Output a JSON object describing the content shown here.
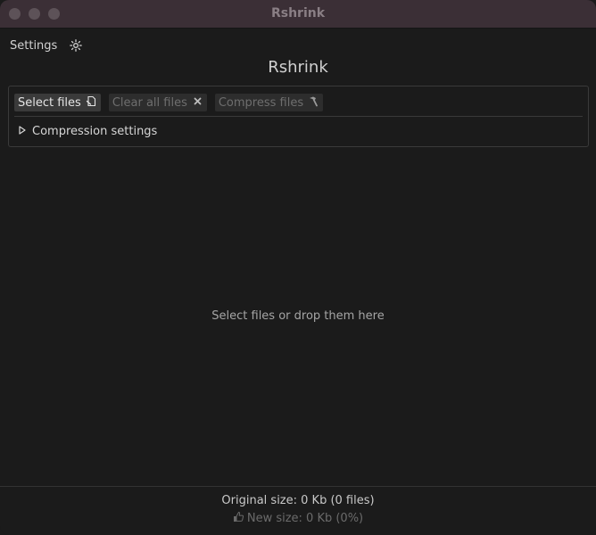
{
  "window": {
    "title": "Rshrink"
  },
  "menu": {
    "settings_label": "Settings",
    "theme_icon": "sun-icon"
  },
  "app": {
    "heading": "Rshrink"
  },
  "toolbar": {
    "select_files_label": "Select files",
    "select_files_icon": "file-hand-icon",
    "clear_all_label": "Clear all files",
    "clear_all_icon": "close-icon",
    "compress_label": "Compress files",
    "compress_icon": "hammer-icon"
  },
  "compression_settings": {
    "label": "Compression settings",
    "expanded": false
  },
  "drop_area": {
    "hint": "Select files or drop them here"
  },
  "status": {
    "original_size": "Original size: 0 Kb (0 files)",
    "new_size": "New size: 0 Kb (0%)",
    "new_size_icon": "thumbs-up-icon"
  },
  "colors": {
    "titlebar": "#3b2f36",
    "background": "#1b1b1b",
    "button": "#3a3a3a",
    "button_disabled": "#2d2d2d"
  }
}
